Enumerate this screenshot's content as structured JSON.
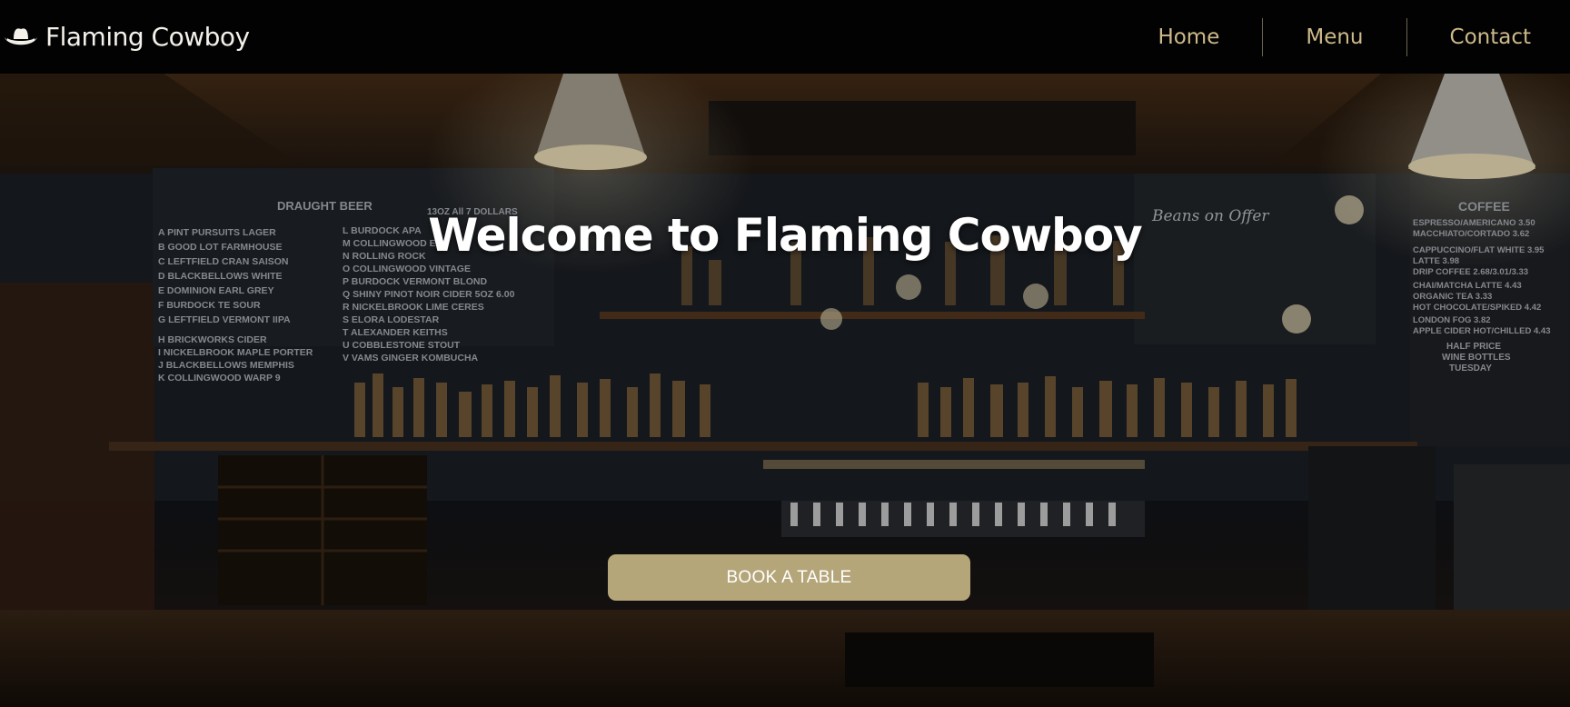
{
  "brand": {
    "name": "Flaming Cowboy",
    "icon": "cowboy-hat-icon"
  },
  "nav": {
    "items": [
      {
        "label": "Home"
      },
      {
        "label": "Menu"
      },
      {
        "label": "Contact"
      }
    ]
  },
  "hero": {
    "title": "Welcome to Flaming Cowboy",
    "cta_label": "BOOK A TABLE",
    "boards": {
      "beer_heading": "DRAUGHT   BEER",
      "beer_size": "13OZ    All 7 DOLLARS",
      "beers_left": [
        "A  PINT PURSUITS  LAGER",
        "B  GOOD LOT   FARMHOUSE",
        "C  LEFTFIELD  CRAN  SAISON",
        "D  BLACKBELLOWS  WHITE",
        "E  DOMINION EARL  GREY",
        "F  BURDOCK  TE   SOUR",
        "G  LEFTFIELD  VERMONT  IIPA",
        "H  BRICKWORKS   CIDER",
        "I  NICKELBROOK  MAPLE  PORTER",
        "J  BLACKBELLOWS  MEMPHIS",
        "K  COLLINGWOOD  WARP 9"
      ],
      "beers_right": [
        "L  BURDOCK   APA",
        "M  COLLINGWOOD  ESB",
        "N  ROLLING  ROCK",
        "O  COLLINGWOOD  VINTAGE",
        "P  BURDOCK  VERMONT  BLOND",
        "Q  SHINY  PINOT NOIR CIDER  5OZ     6.00",
        "R  NICKELBROOK  LIME  CERES",
        "S  ELORA  LODESTAR",
        "T  ALEXANDER   KEITHS",
        "U  COBBLESTONE  STOUT",
        "V  VAMS  GINGER  KOMBUCHA"
      ],
      "coffee_heading": "COFFEE",
      "coffee_items": [
        "ESPRESSO/AMERICANO    3.50",
        "MACCHIATO/CORTADO     3.62",
        "CAPPUCCINO/FLAT WHITE  3.95",
        "LATTE                        3.98",
        "DRIP COFFEE    2.68/3.01/3.33",
        "CHAI/MATCHA LATTE      4.43",
        "ORGANIC TEA              3.33",
        "HOT CHOCOLATE/SPIKED  4.42",
        "LONDON FOG               3.82",
        "APPLE CIDER HOT/CHILLED 4.43"
      ],
      "coffee_footer": [
        "HALF  PRICE",
        "WINE BOTTLES",
        "TUESDAY"
      ],
      "chalk_heading": "Beans on Offer"
    }
  }
}
